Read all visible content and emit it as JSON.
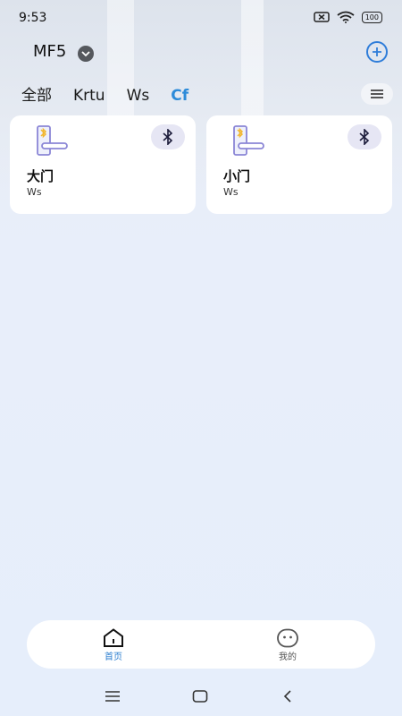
{
  "status_bar": {
    "time": "9:53",
    "battery": "100"
  },
  "header": {
    "home_name": "MF5"
  },
  "tabs": [
    {
      "label": "全部",
      "active": false
    },
    {
      "label": "Krtu",
      "active": false
    },
    {
      "label": "Ws",
      "active": false
    },
    {
      "label": "Cf",
      "active": true
    }
  ],
  "devices": [
    {
      "name": "大门",
      "room": "Ws",
      "icon": "smart-lock-icon",
      "connection": "bluetooth-icon"
    },
    {
      "name": "小门",
      "room": "Ws",
      "icon": "smart-lock-icon",
      "connection": "bluetooth-icon"
    }
  ],
  "bottom_nav": [
    {
      "label": "首页",
      "icon": "home-icon",
      "active": true
    },
    {
      "label": "我的",
      "icon": "profile-face-icon",
      "active": false
    }
  ],
  "colors": {
    "accent": "#2d8bd9",
    "background": "#e8eefa",
    "card": "#ffffff"
  }
}
